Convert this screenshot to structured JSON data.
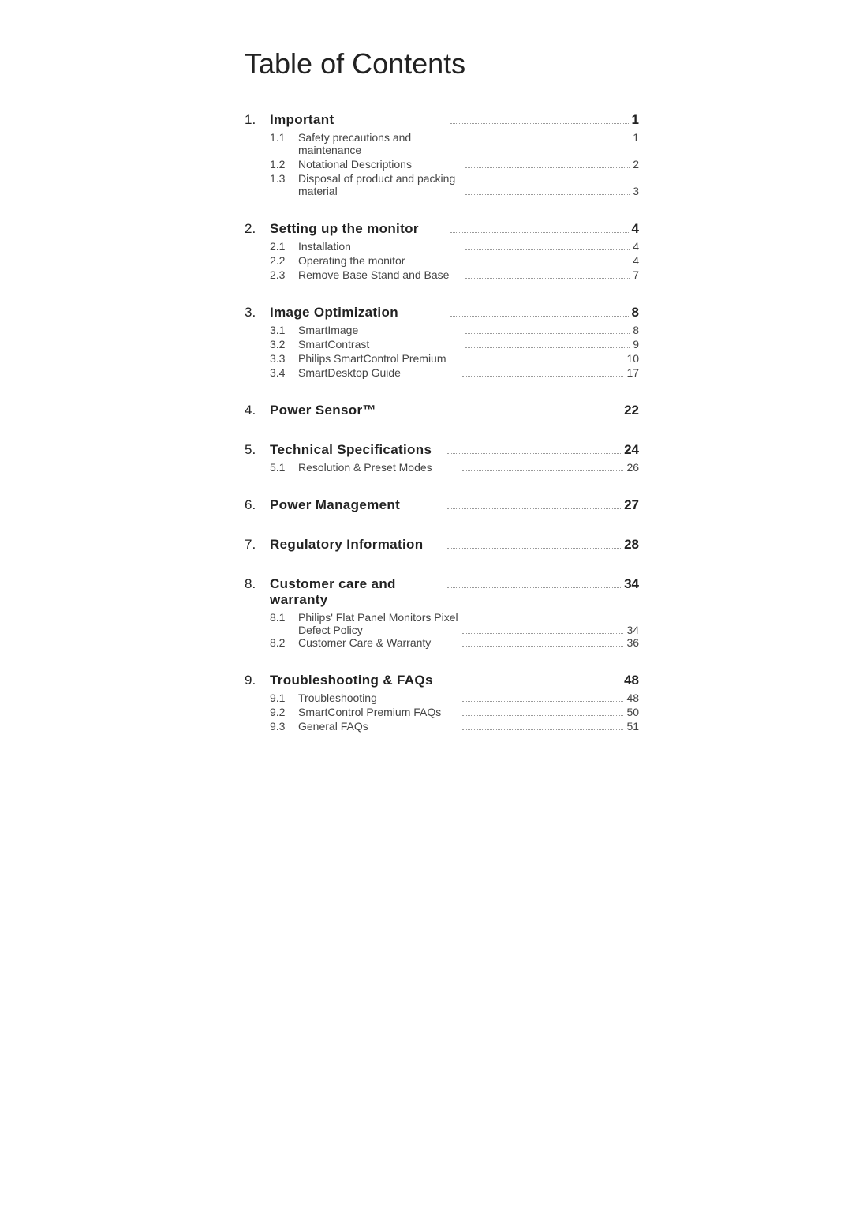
{
  "page": {
    "title": "Table of Contents"
  },
  "sections": [
    {
      "number": "1.",
      "label": "Important",
      "page": "1",
      "subsections": [
        {
          "number": "1.1",
          "label": "Safety precautions and maintenance",
          "page": "1"
        },
        {
          "number": "1.2",
          "label": "Notational Descriptions",
          "page": "2"
        },
        {
          "number": "1.3",
          "label": "Disposal of product and packing",
          "page": "3",
          "multiline": true,
          "line2": "material"
        }
      ]
    },
    {
      "number": "2.",
      "label": "Setting up the monitor",
      "page": "4",
      "subsections": [
        {
          "number": "2.1",
          "label": "Installation",
          "page": "4"
        },
        {
          "number": "2.2",
          "label": "Operating the monitor",
          "page": "4"
        },
        {
          "number": "2.3",
          "label": "Remove Base Stand and Base",
          "page": "7"
        }
      ]
    },
    {
      "number": "3.",
      "label": "Image Optimization",
      "page": "8",
      "subsections": [
        {
          "number": "3.1",
          "label": "SmartImage",
          "page": "8"
        },
        {
          "number": "3.2",
          "label": "SmartContrast",
          "page": "9"
        },
        {
          "number": "3.3",
          "label": "Philips SmartControl Premium",
          "page": "10"
        },
        {
          "number": "3.4",
          "label": "SmartDesktop Guide",
          "page": "17"
        }
      ]
    },
    {
      "number": "4.",
      "label": "Power Sensor™",
      "page": "22",
      "subsections": []
    },
    {
      "number": "5.",
      "label": "Technical Specifications",
      "page": "24",
      "subsections": [
        {
          "number": "5.1",
          "label": "Resolution & Preset Modes",
          "page": "26"
        }
      ]
    },
    {
      "number": "6.",
      "label": "Power Management",
      "page": "27",
      "subsections": []
    },
    {
      "number": "7.",
      "label": "Regulatory Information",
      "page": "28",
      "subsections": []
    },
    {
      "number": "8.",
      "label": "Customer care and warranty",
      "page": "34",
      "subsections": [
        {
          "number": "8.1",
          "label": "Philips' Flat Panel Monitors Pixel",
          "page": "34",
          "multiline": true,
          "line2": "Defect Policy"
        },
        {
          "number": "8.2",
          "label": "Customer Care & Warranty",
          "page": "36"
        }
      ]
    },
    {
      "number": "9.",
      "label": "Troubleshooting & FAQs",
      "page": "48",
      "subsections": [
        {
          "number": "9.1",
          "label": "Troubleshooting",
          "page": "48"
        },
        {
          "number": "9.2",
          "label": "SmartControl Premium FAQs",
          "page": "50"
        },
        {
          "number": "9.3",
          "label": "General FAQs",
          "page": "51"
        }
      ]
    }
  ]
}
